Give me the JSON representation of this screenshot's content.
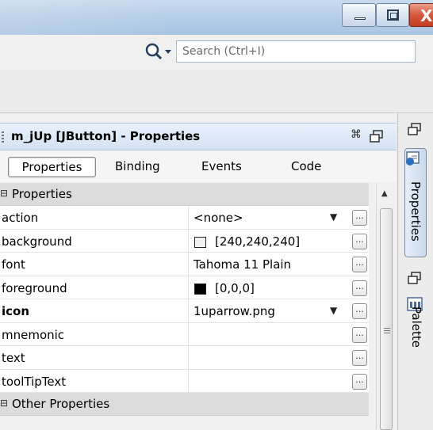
{
  "window": {
    "minimize_icon": "minimize-icon",
    "maximize_icon": "restore-icon",
    "close_glyph": "X"
  },
  "search": {
    "placeholder": "Search (Ctrl+I)",
    "icon": "search-icon"
  },
  "properties_window": {
    "title": "m_jUp [JButton] - Properties",
    "tabs": [
      {
        "label": "Properties",
        "active": true
      },
      {
        "label": "Binding"
      },
      {
        "label": "Events"
      },
      {
        "label": "Code"
      }
    ],
    "categories": {
      "properties": "Properties",
      "other_properties": "Other Properties"
    },
    "rows": [
      {
        "name": "action",
        "value": "<none>"
      },
      {
        "name": "background",
        "value": "[240,240,240]",
        "swatch_color": "#f0f0f0"
      },
      {
        "name": "font",
        "value": "Tahoma 11 Plain"
      },
      {
        "name": "foreground",
        "value": "[0,0,0]",
        "swatch_color": "#000000"
      },
      {
        "name": "icon",
        "value": "1uparrow.png"
      },
      {
        "name": "mnemonic",
        "value": ""
      },
      {
        "name": "text",
        "value": ""
      },
      {
        "name": "toolTipText",
        "value": ""
      }
    ]
  },
  "side_strip": {
    "properties_tab": "Properties",
    "palette_tab": "Palette"
  }
}
